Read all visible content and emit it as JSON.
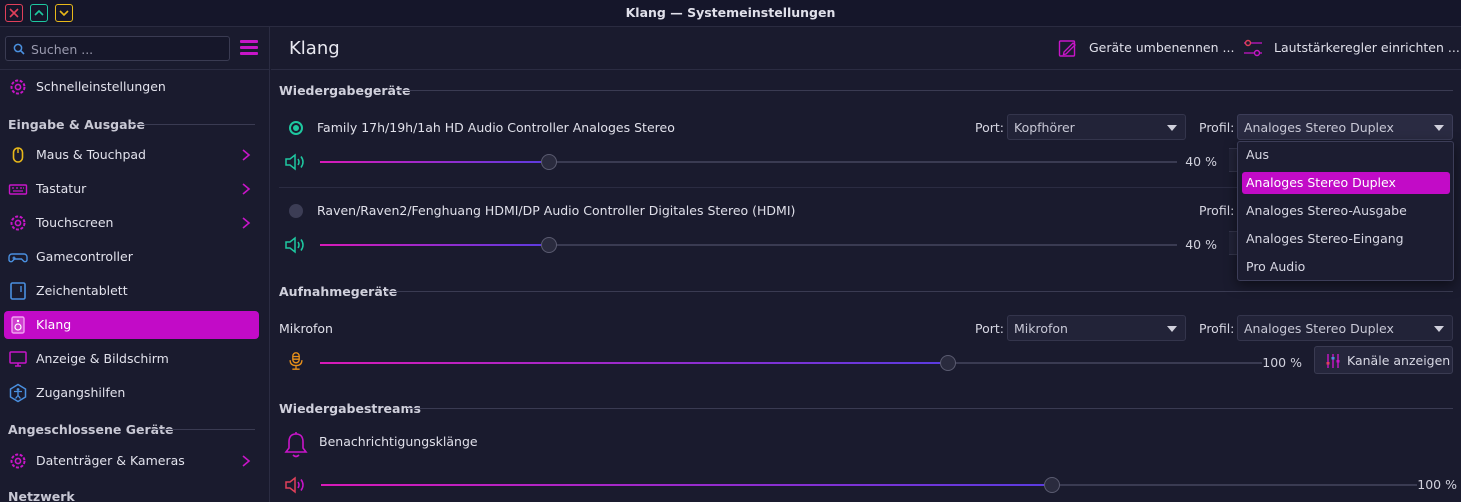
{
  "window": {
    "title": "Klang — Systemeinstellungen"
  },
  "colors": {
    "accent": "#c20bc7",
    "background": "#1a1b2e",
    "radio": "#1ec8a0",
    "mic_icon": "#e8901a"
  },
  "sidebar": {
    "search_placeholder": "Suchen ...",
    "quick_settings": "Schnelleinstellungen",
    "section_io": "Eingabe & Ausgabe",
    "items": [
      {
        "label": "Maus & Touchpad",
        "icon": "mouse-icon",
        "chevron": true
      },
      {
        "label": "Tastatur",
        "icon": "keyboard-icon",
        "chevron": true
      },
      {
        "label": "Touchscreen",
        "icon": "gear-icon",
        "chevron": true
      },
      {
        "label": "Gamecontroller",
        "icon": "gamepad-icon",
        "chevron": false
      },
      {
        "label": "Zeichentablett",
        "icon": "tablet-icon",
        "chevron": false
      },
      {
        "label": "Klang",
        "icon": "speaker-icon",
        "chevron": false,
        "active": true
      },
      {
        "label": "Anzeige & Bildschirm",
        "icon": "monitor-icon",
        "chevron": false
      },
      {
        "label": "Zugangshilfen",
        "icon": "accessibility-icon",
        "chevron": false
      }
    ],
    "section_devices": "Angeschlossene Geräte",
    "devices_item": "Datenträger & Kameras",
    "section_network": "Netzwerk"
  },
  "header": {
    "page_title": "Klang",
    "rename_devices": "Geräte umbenennen ...",
    "volume_control": "Lautstärkeregler einrichten ..."
  },
  "playback": {
    "group_title": "Wiedergabegeräte",
    "devices": [
      {
        "name": "Family 17h/19h/1ah HD Audio Controller Analoges Stereo",
        "port_label": "Port:",
        "port_value": "Kopfhörer",
        "profile_label": "Profil:",
        "profile_value": "Analoges Stereo Duplex",
        "volume": 40,
        "volume_text": "40 %",
        "default": true
      },
      {
        "name": "Raven/Raven2/Fenghuang HDMI/DP Audio Controller Digitales Stereo (HDMI)",
        "profile_label": "Profil:",
        "volume": 40,
        "volume_text": "40 %",
        "default": false
      }
    ]
  },
  "profile_dropdown": {
    "options": [
      "Aus",
      "Analoges Stereo Duplex",
      "Analoges Stereo-Ausgabe",
      "Analoges Stereo-Eingang",
      "Pro Audio"
    ],
    "selected": "Analoges Stereo Duplex"
  },
  "recording": {
    "group_title": "Aufnahmegeräte",
    "device": {
      "name": "Mikrofon",
      "port_label": "Port:",
      "port_value": "Mikrofon",
      "profile_label": "Profil:",
      "profile_value": "Analoges Stereo Duplex",
      "volume": 100,
      "volume_text": "100 %",
      "channels_button": "Kanäle anzeigen"
    }
  },
  "streams": {
    "group_title": "Wiedergabestreams",
    "stream": {
      "name": "Benachrichtigungsklänge",
      "volume": 100,
      "volume_text": "100 %"
    }
  }
}
